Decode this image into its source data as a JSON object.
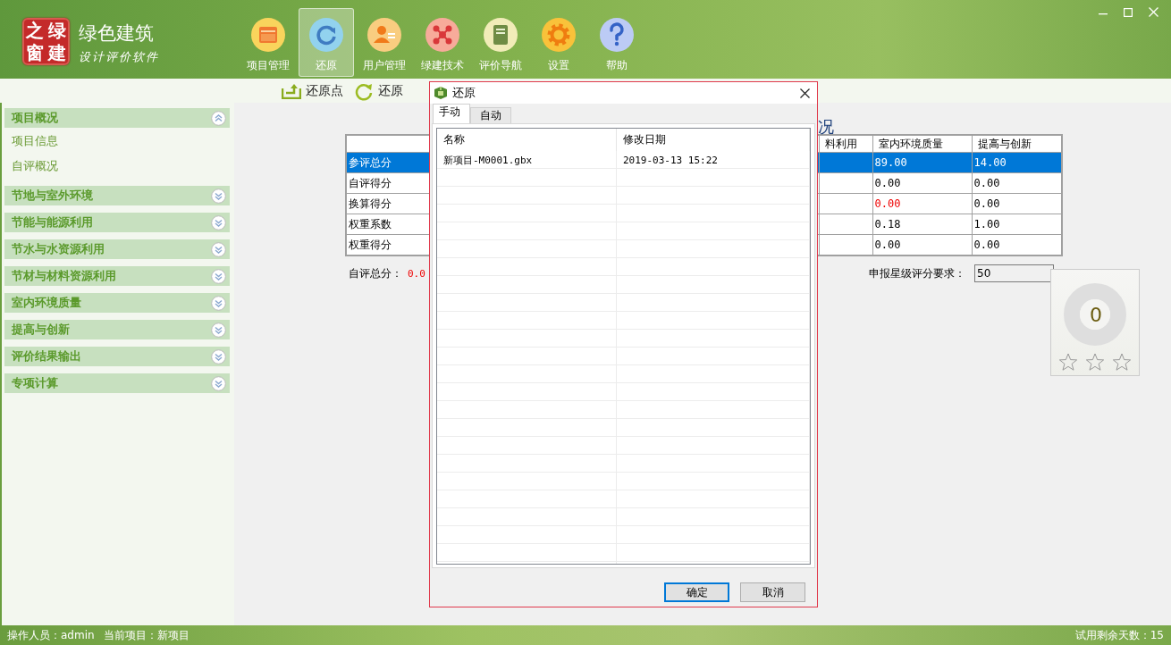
{
  "app": {
    "logo_chars": [
      "之",
      "绿",
      "窗",
      "建"
    ],
    "title": "绿色建筑",
    "subtitle": "设计评价软件"
  },
  "toolbar": [
    {
      "label": "项目管理",
      "kind": "project",
      "selected": false
    },
    {
      "label": "还原",
      "kind": "restore",
      "selected": true
    },
    {
      "label": "用户管理",
      "kind": "users",
      "selected": false
    },
    {
      "label": "绿建技术",
      "kind": "tech",
      "selected": false
    },
    {
      "label": "评价导航",
      "kind": "guide",
      "selected": false
    },
    {
      "label": "设置",
      "kind": "settings",
      "selected": false
    },
    {
      "label": "帮助",
      "kind": "help",
      "selected": false
    }
  ],
  "subtoolbar": [
    {
      "label": "还原点",
      "kind": "restore-point"
    },
    {
      "label": "还原",
      "kind": "restore"
    }
  ],
  "sidebar": {
    "sections": [
      {
        "label": "项目概况",
        "expanded": true,
        "children": [
          {
            "label": "项目信息"
          },
          {
            "label": "自评概况"
          }
        ]
      },
      {
        "label": "节地与室外环境",
        "expanded": false
      },
      {
        "label": "节能与能源利用",
        "expanded": false
      },
      {
        "label": "节水与水资源利用",
        "expanded": false
      },
      {
        "label": "节材与材料资源利用",
        "expanded": false
      },
      {
        "label": "室内环境质量",
        "expanded": false
      },
      {
        "label": "提高与创新",
        "expanded": false
      },
      {
        "label": "评价结果输出",
        "expanded": false
      },
      {
        "label": "专项计算",
        "expanded": false
      }
    ]
  },
  "summary": {
    "title": "况",
    "table": {
      "columns": [
        "料利用",
        "室内环境质量",
        "提高与创新"
      ],
      "rows": [
        {
          "label": "参评总分",
          "selected": true,
          "values": [
            {
              "text": "89.00",
              "alert": false
            },
            {
              "text": "14.00",
              "alert": false
            }
          ]
        },
        {
          "label": "自评得分",
          "selected": false,
          "values": [
            {
              "text": "0.00",
              "alert": false
            },
            {
              "text": "0.00",
              "alert": false
            }
          ]
        },
        {
          "label": "换算得分",
          "selected": false,
          "values": [
            {
              "text": "0.00",
              "alert": true
            },
            {
              "text": "0.00",
              "alert": false
            }
          ]
        },
        {
          "label": "权重系数",
          "selected": false,
          "values": [
            {
              "text": "0.18",
              "alert": false
            },
            {
              "text": "1.00",
              "alert": false
            }
          ]
        },
        {
          "label": "权重得分",
          "selected": false,
          "values": [
            {
              "text": "0.00",
              "alert": false
            },
            {
              "text": "0.00",
              "alert": false
            }
          ]
        }
      ]
    },
    "total": {
      "label": "自评总分：",
      "value": "0.0"
    },
    "requirement": {
      "label": "申报星级评分要求：",
      "value": "50"
    },
    "star_card": {
      "score": "0",
      "stars": 0
    }
  },
  "dialog": {
    "title": "还原",
    "tabs": [
      {
        "label": "手动",
        "selected": true
      },
      {
        "label": "自动",
        "selected": false
      }
    ],
    "columns": [
      "名称",
      "修改日期"
    ],
    "rows": [
      {
        "cells": [
          "新项目-M0001.gbx",
          "2019-03-13 15:22"
        ]
      }
    ],
    "buttons": [
      {
        "label": "确定",
        "default": true
      },
      {
        "label": "取消",
        "default": false
      }
    ]
  },
  "status_bar": {
    "left": [
      "操作人员：admin",
      "当前项目：新项目"
    ],
    "right": "试用剩余天数：15"
  }
}
